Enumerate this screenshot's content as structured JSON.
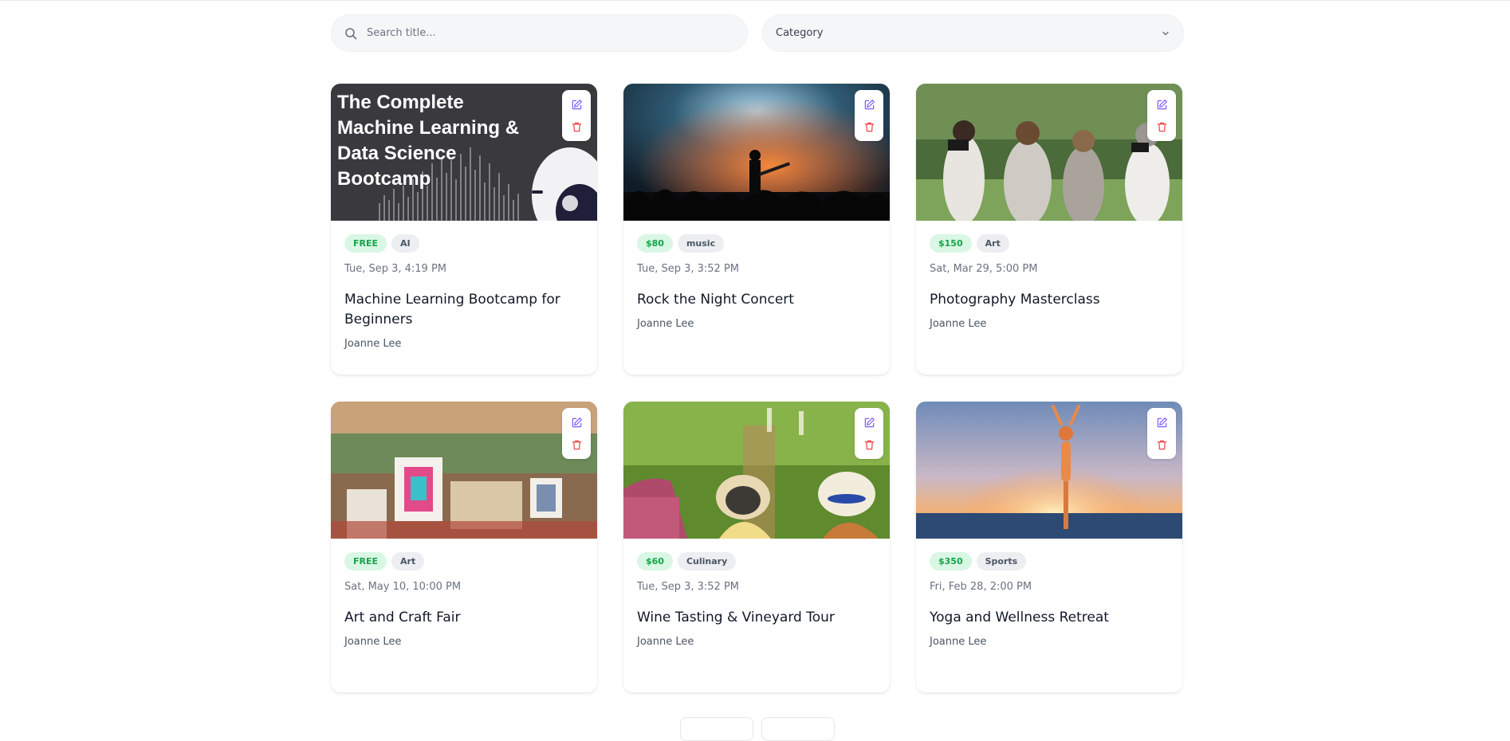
{
  "search": {
    "placeholder": "Search title..."
  },
  "category_select": {
    "value": "Category"
  },
  "colors": {
    "accent": "#7c5cff",
    "danger": "#ef4444",
    "price_green": "#16a34a"
  },
  "events": [
    {
      "price": "FREE",
      "category": "AI",
      "date": "Tue, Sep 3, 4:19 PM",
      "title": "Machine Learning Bootcamp for Beginners",
      "host": "Joanne Lee",
      "image_text": "The Complete Machine Learning & Data Science Bootcamp"
    },
    {
      "price": "$80",
      "category": "music",
      "date": "Tue, Sep 3, 3:52 PM",
      "title": "Rock the Night Concert",
      "host": "Joanne Lee"
    },
    {
      "price": "$150",
      "category": "Art",
      "date": "Sat, Mar 29, 5:00 PM",
      "title": "Photography Masterclass",
      "host": "Joanne Lee"
    },
    {
      "price": "FREE",
      "category": "Art",
      "date": "Sat, May 10, 10:00 PM",
      "title": "Art and Craft Fair",
      "host": "Joanne Lee"
    },
    {
      "price": "$60",
      "category": "Culinary",
      "date": "Tue, Sep 3, 3:52 PM",
      "title": "Wine Tasting & Vineyard Tour",
      "host": "Joanne Lee"
    },
    {
      "price": "$350",
      "category": "Sports",
      "date": "Fri, Feb 28, 2:00 PM",
      "title": "Yoga and Wellness Retreat",
      "host": "Joanne Lee"
    }
  ],
  "icons": {
    "search": "search-icon",
    "chevron": "chevron-down-icon",
    "edit": "edit-icon",
    "delete": "trash-icon"
  }
}
